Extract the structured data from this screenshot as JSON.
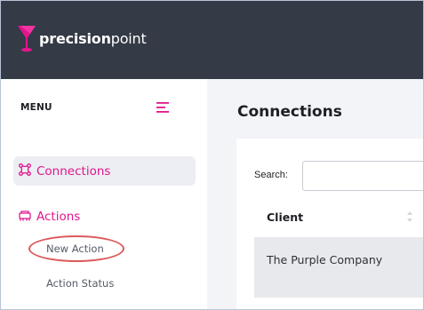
{
  "brand": {
    "logo_text_bold": "precision",
    "logo_text_light": "point",
    "accent_color": "#e0168d"
  },
  "sidebar": {
    "menu_label": "MENU",
    "toggle_icon": "hamburger-menu-icon",
    "items": [
      {
        "label": "Connections",
        "icon": "connections-icon",
        "active": true
      },
      {
        "label": "Actions",
        "icon": "actions-icon",
        "active": false
      }
    ],
    "sub_items": [
      {
        "label": "New Action",
        "highlighted": true
      },
      {
        "label": "Action Status",
        "highlighted": false
      }
    ]
  },
  "main": {
    "page_title": "Connections",
    "search": {
      "label": "Search:",
      "value": ""
    },
    "table": {
      "columns": [
        "Client"
      ],
      "rows": [
        [
          "The Purple Company"
        ]
      ]
    }
  },
  "colors": {
    "topbar": "#343a46",
    "highlight_ring": "#dc5a5a"
  }
}
